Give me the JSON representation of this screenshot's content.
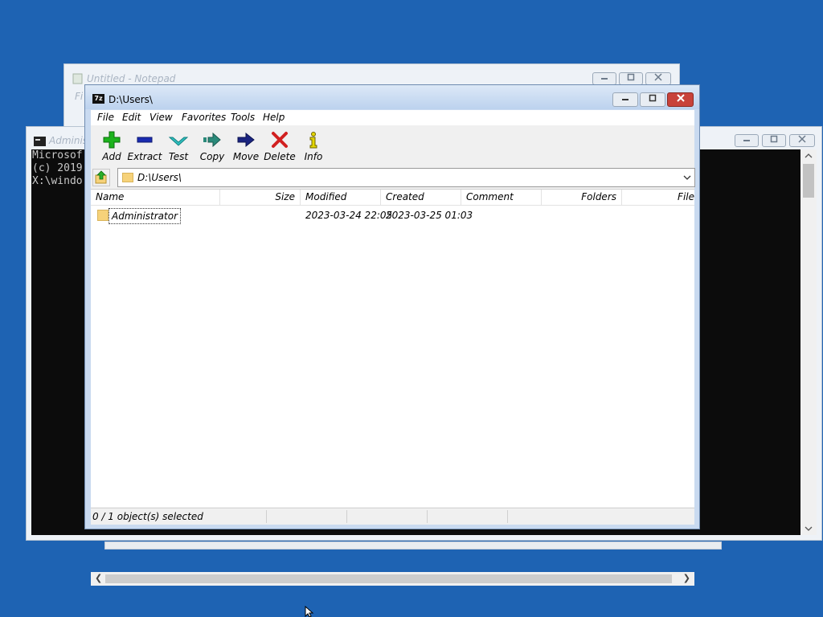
{
  "notepad": {
    "title": "Untitled - Notepad",
    "menu_peek": "Fi"
  },
  "cmd": {
    "title": "Adminis",
    "lines": [
      "Microsof",
      "(c) 2019",
      "",
      "X:\\windo"
    ]
  },
  "sevenzip": {
    "icon_label": "7z",
    "title": "D:\\Users\\",
    "menu": [
      "File",
      "Edit",
      "View",
      "Favorites",
      "Tools",
      "Help"
    ],
    "toolbar": [
      {
        "label": "Add",
        "icon": "plus-icon",
        "color": "#1db31d"
      },
      {
        "label": "Extract",
        "icon": "minus-icon",
        "color": "#1a2bb0"
      },
      {
        "label": "Test",
        "icon": "check-icon",
        "color": "#2fbfbf"
      },
      {
        "label": "Copy",
        "icon": "arrow-copy-icon",
        "color": "#2a8a7a"
      },
      {
        "label": "Move",
        "icon": "arrow-move-icon",
        "color": "#1a2480"
      },
      {
        "label": "Delete",
        "icon": "x-icon",
        "color": "#d12020"
      },
      {
        "label": "Info",
        "icon": "info-icon",
        "color": "#e5d600"
      }
    ],
    "address": "D:\\Users\\",
    "columns": [
      "Name",
      "Size",
      "Modified",
      "Created",
      "Comment",
      "Folders",
      "File"
    ],
    "rows": [
      {
        "name": "Administrator",
        "size": "",
        "modified": "2023-03-24 22:05",
        "created": "2023-03-25 01:03",
        "comment": "",
        "folders": "",
        "files": ""
      }
    ],
    "status": [
      "0 / 1 object(s) selected",
      "",
      "",
      ""
    ]
  }
}
